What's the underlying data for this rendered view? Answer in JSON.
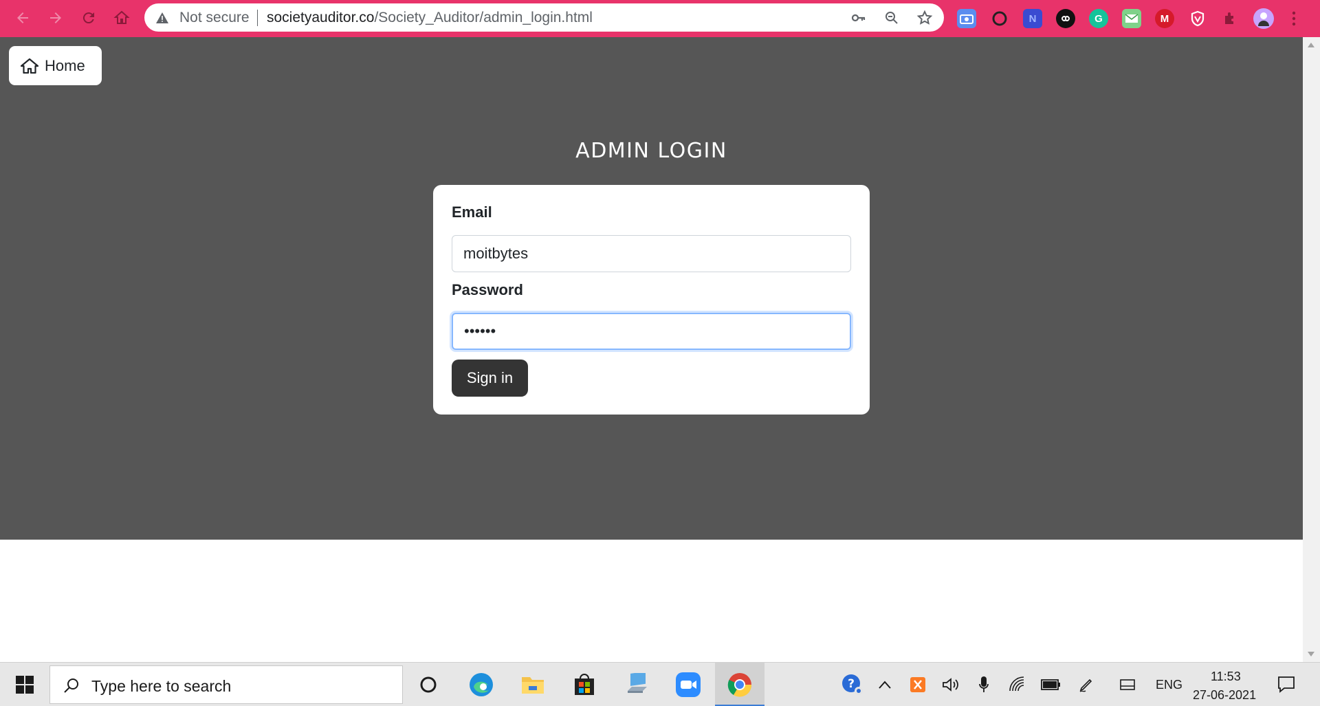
{
  "browser": {
    "security_label": "Not secure",
    "url_host": "societyauditor.co",
    "url_path": "/Society_Auditor/admin_login.html",
    "theme_color": "#e8336a",
    "extensions": [
      "screenshot-extension-icon",
      "circle-extension-icon",
      "n-extension-icon",
      "infinity-extension-icon",
      "grammarly-icon",
      "mail-checker-icon",
      "m-extension-icon",
      "shield-extension-icon",
      "puzzle-icon",
      "profile-avatar"
    ]
  },
  "page": {
    "home_label": "Home",
    "title": "ADMIN LOGIN",
    "hero_color": "#565656",
    "form": {
      "email_label": "Email",
      "email_value": "moitbytes",
      "password_label": "Password",
      "password_value": "••••••",
      "submit_label": "Sign in"
    }
  },
  "taskbar": {
    "search_placeholder": "Type here to search",
    "language": "ENG",
    "time": "11:53",
    "date": "27-06-2021",
    "pinned_apps": [
      "cortana-icon",
      "edge-icon",
      "file-explorer-icon",
      "store-icon",
      "laptop-app-icon",
      "zoom-icon",
      "chrome-icon"
    ]
  }
}
